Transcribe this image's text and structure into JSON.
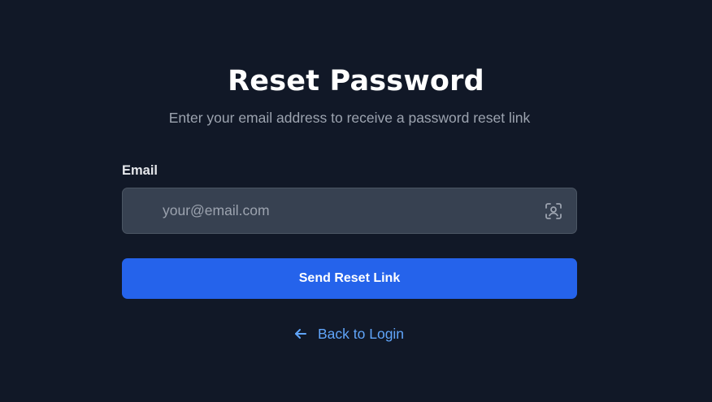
{
  "page": {
    "title": "Reset Password",
    "subtitle": "Enter your email address to receive a password reset link"
  },
  "form": {
    "email_label": "Email",
    "email_value": "",
    "email_placeholder": "your@email.com",
    "email_trailing_icon": "face-scan-icon",
    "submit_label": "Send Reset Link"
  },
  "footer": {
    "back_icon": "arrow-left-icon",
    "back_label": "Back to Login"
  },
  "colors": {
    "background": "#111827",
    "input_background": "#374151",
    "input_border": "#4b5563",
    "primary": "#2563eb",
    "link": "#60a5fa",
    "muted_text": "#9ca3af"
  }
}
